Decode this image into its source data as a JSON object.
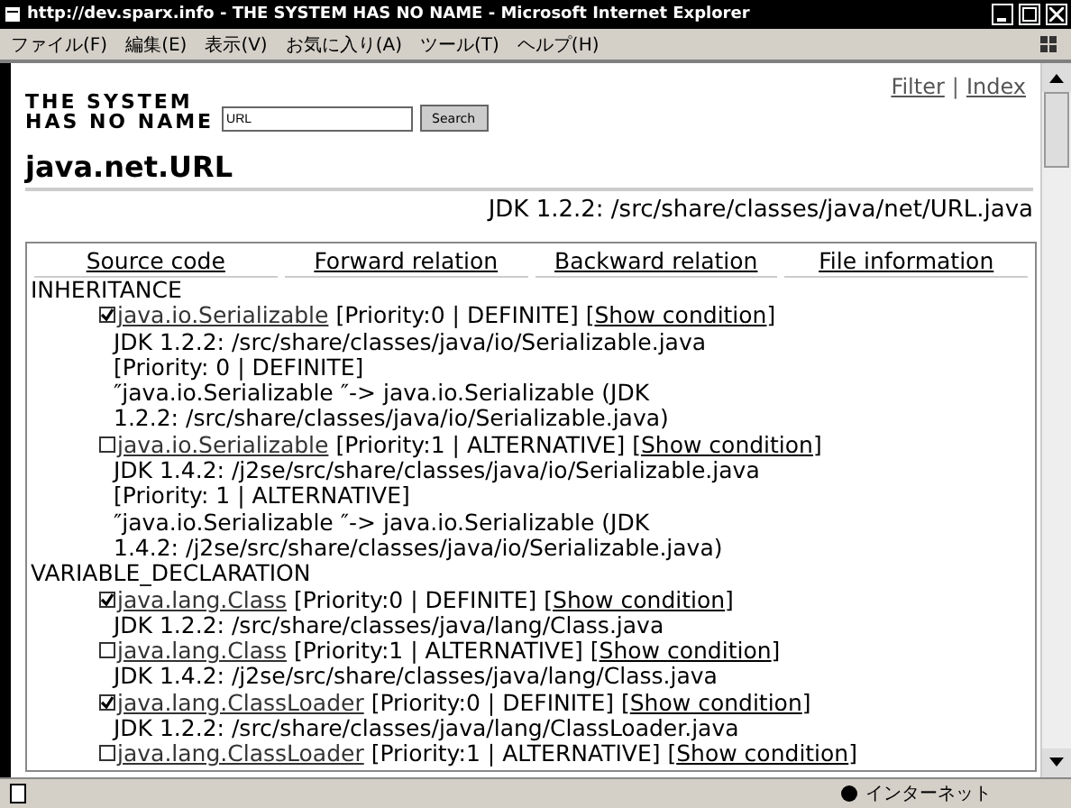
{
  "window": {
    "title": "http://dev.sparx.info - THE SYSTEM HAS NO NAME - Microsoft Internet Explorer"
  },
  "menu": [
    "ファイル(F)",
    "編集(E)",
    "表示(V)",
    "お気に入り(A)",
    "ツール(T)",
    "ヘルプ(H)"
  ],
  "header": {
    "logo_lines": [
      "THE SYSTEM",
      "HAS NO NAME"
    ],
    "search": {
      "value": "URL",
      "button": "Search"
    },
    "links": [
      "Filter",
      "Index"
    ],
    "separator": "|"
  },
  "page_title": "java.net.URL",
  "source_path": "JDK 1.2.2: /src/share/classes/java/net/URL.java",
  "tabs": [
    "Source code",
    "Forward relation",
    "Backward relation",
    "File information"
  ],
  "sections": [
    {
      "heading": "INHERITANCE",
      "entries": [
        {
          "checked": true,
          "name": "java.io.Serializable",
          "tag": "[Priority:0 | DEFINITE]",
          "condition": "Show condition",
          "details": [
            "JDK 1.2.2: /src/share/classes/java/io/Serializable.java",
            "[Priority: 0 | DEFINITE]",
            "″java.io.Serializable ″-> java.io.Serializable (JDK",
            "1.2.2: /src/share/classes/java/io/Serializable.java)"
          ]
        },
        {
          "checked": false,
          "name": "java.io.Serializable",
          "tag": "[Priority:1 | ALTERNATIVE]",
          "condition": "Show condition",
          "details": [
            "JDK 1.4.2: /j2se/src/share/classes/java/io/Serializable.java",
            "[Priority: 1 | ALTERNATIVE]",
            "″java.io.Serializable ″-> java.io.Serializable (JDK",
            "1.4.2: /j2se/src/share/classes/java/io/Serializable.java)"
          ]
        }
      ]
    },
    {
      "heading": "VARIABLE_DECLARATION",
      "entries": [
        {
          "checked": true,
          "name": "java.lang.Class",
          "tag": "[Priority:0 | DEFINITE]",
          "condition": "Show condition",
          "details": [
            "JDK 1.2.2: /src/share/classes/java/lang/Class.java"
          ]
        },
        {
          "checked": false,
          "name": "java.lang.Class",
          "tag": "[Priority:1 | ALTERNATIVE]",
          "condition": "Show condition",
          "details": [
            "JDK 1.4.2: /j2se/src/share/classes/java/lang/Class.java"
          ]
        },
        {
          "checked": true,
          "name": "java.lang.ClassLoader",
          "tag": "[Priority:0 | DEFINITE]",
          "condition": "Show condition",
          "details": [
            "JDK 1.2.2: /src/share/classes/java/lang/ClassLoader.java"
          ]
        },
        {
          "checked": false,
          "name": "java.lang.ClassLoader",
          "tag": "[Priority:1 | ALTERNATIVE]",
          "condition": "Show condition"
        }
      ]
    }
  ],
  "brackets": [
    "[",
    "]"
  ],
  "status_bar": {
    "zone": "インターネット"
  }
}
